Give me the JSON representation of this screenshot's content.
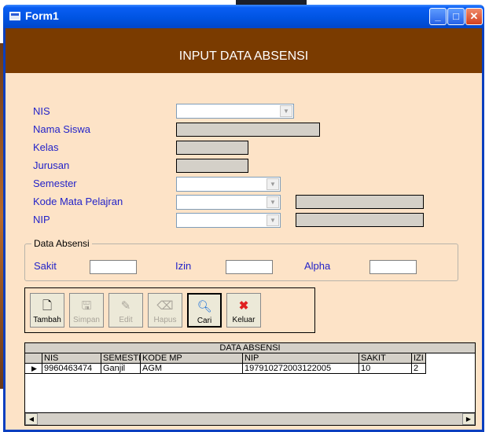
{
  "window": {
    "title": "Form1"
  },
  "header": {
    "title": "INPUT DATA ABSENSI"
  },
  "form": {
    "labels": {
      "nis": "NIS",
      "nama_siswa": "Nama Siswa",
      "kelas": "Kelas",
      "jurusan": "Jurusan",
      "semester": "Semester",
      "kode_mp": "Kode Mata Pelajran",
      "nip": "NIP"
    }
  },
  "absensi": {
    "group_title": "Data Absensi",
    "sakit": "Sakit",
    "izin": "Izin",
    "alpha": "Alpha"
  },
  "toolbar": {
    "tambah": "Tambah",
    "simpan": "Simpan",
    "edit": "Edit",
    "hapus": "Hapus",
    "cari": "Cari",
    "keluar": "Keluar"
  },
  "grid": {
    "caption": "DATA ABSENSI",
    "columns": [
      "NIS",
      "SEMESTE",
      "KODE MP",
      "NIP",
      "SAKIT",
      "IZI"
    ],
    "rows": [
      [
        "9960463474",
        "Ganjil",
        "AGM",
        "197910272003122005",
        "10",
        "2"
      ]
    ]
  },
  "colors": {
    "header_band": "#7a3b00",
    "form_background": "#fde3c7",
    "label_text": "#2323c8",
    "titlebar": "#0054e3"
  }
}
